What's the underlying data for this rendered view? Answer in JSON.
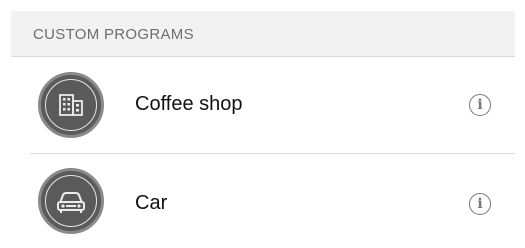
{
  "section": {
    "title": "CUSTOM PROGRAMS"
  },
  "programs": [
    {
      "label": "Coffee shop",
      "icon": "building-icon",
      "info_icon": "info-icon"
    },
    {
      "label": "Car",
      "icon": "car-icon",
      "info_icon": "info-icon"
    }
  ],
  "colors": {
    "header_bg": "#f2f2f2",
    "header_text": "#6d6d72",
    "avatar_bg": "#5a5a5a",
    "info": "#777777"
  }
}
